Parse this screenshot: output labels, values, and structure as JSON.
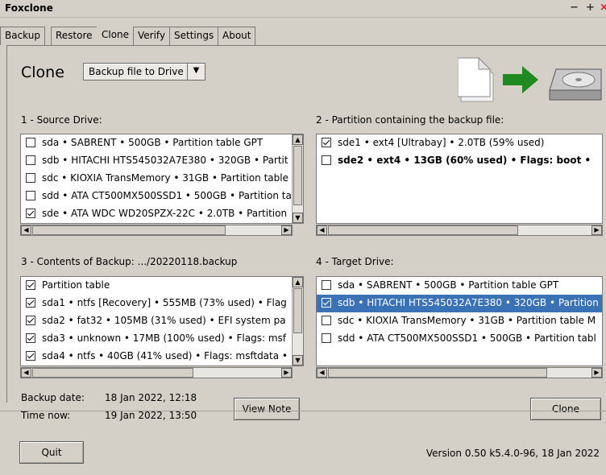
{
  "window": {
    "title": "Foxclone",
    "minimize": "−",
    "maximize": "+",
    "close": "×"
  },
  "tabs": [
    "Backup",
    "Restore",
    "Clone",
    "Verify",
    "Settings",
    "About"
  ],
  "active_tab": "Clone",
  "heading": "Clone",
  "mode_select": {
    "value": "Backup file to Drive"
  },
  "source": {
    "label": "1 - Source Drive:",
    "rows": [
      {
        "text": "sda • SABRENT • 500GB • Partition table GPT",
        "checked": false
      },
      {
        "text": "sdb • HITACHI HTS545032A7E380 • 320GB • Partit",
        "checked": false
      },
      {
        "text": "sdc • KIOXIA TransMemory • 31GB • Partition table",
        "checked": false
      },
      {
        "text": "sdd • ATA CT500MX500SSD1 • 500GB • Partition ta",
        "checked": false
      },
      {
        "text": "sde • ATA WDC WD20SPZX-22C • 2.0TB • Partition",
        "checked": true
      }
    ]
  },
  "partition": {
    "label": "2 - Partition containing the backup file:",
    "rows": [
      {
        "text": "sde1 • ext4 [Ultrabay] • 2.0TB (59% used)",
        "checked": true
      },
      {
        "text": "sde2 • ext4 • 13GB (60% used) • Flags: boot •",
        "checked": false,
        "bold": true
      }
    ]
  },
  "contents": {
    "label": "3 - Contents of Backup: .../20220118.backup",
    "rows": [
      {
        "text": "Partition table",
        "checked": true
      },
      {
        "text": "sda1 • ntfs [Recovery] • 555MB (73% used) • Flag",
        "checked": true
      },
      {
        "text": "sda2 • fat32 • 105MB (31% used) • EFI system pa",
        "checked": true
      },
      {
        "text": "sda3 • unknown • 17MB (100% used) • Flags: msf",
        "checked": true
      },
      {
        "text": "sda4 • ntfs • 40GB (41% used) • Flags: msftdata •",
        "checked": true
      }
    ]
  },
  "target": {
    "label": "4 - Target Drive:",
    "rows": [
      {
        "text": "sda • SABRENT • 500GB • Partition table GPT",
        "checked": false
      },
      {
        "text": "sdb • HITACHI HTS545032A7E380 • 320GB • Partition",
        "checked": true,
        "selected": true
      },
      {
        "text": "sdc • KIOXIA TransMemory • 31GB • Partition table M",
        "checked": false
      },
      {
        "text": "sdd • ATA CT500MX500SSD1 • 500GB • Partition tabl",
        "checked": false
      }
    ]
  },
  "info": {
    "backup_date_label": "Backup date:",
    "backup_date_value": "18 Jan 2022, 12:18",
    "time_now_label": "Time now:",
    "time_now_value": "19 Jan 2022, 13:50"
  },
  "buttons": {
    "view_note": "View Note",
    "clone": "Clone",
    "quit": "Quit"
  },
  "version": "Version 0.50 k5.4.0-96, 18 Jan 2022",
  "colors": {
    "selection": "#3a72b5",
    "arrow": "#1f8a1f",
    "window_bg": "#d4d0c8"
  }
}
